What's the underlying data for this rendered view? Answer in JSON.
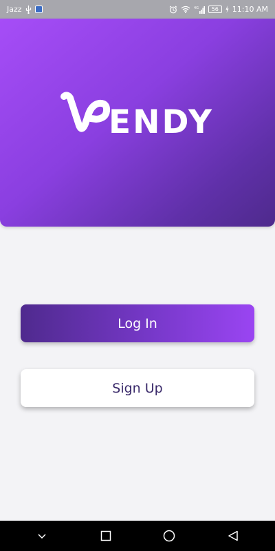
{
  "status_bar": {
    "carrier": "Jazz",
    "signal_type": "4G",
    "battery_level": "56",
    "time": "11:10 AM"
  },
  "brand": {
    "logo_text": "ENDY",
    "logo_full": "VENDY"
  },
  "actions": {
    "login_label": "Log In",
    "signup_label": "Sign Up"
  },
  "colors": {
    "header_gradient_start": "#a64df7",
    "header_gradient_end": "#4e2a8c",
    "login_gradient_start": "#4f2a8e",
    "login_gradient_end": "#9a45f2",
    "signup_text": "#3a2a6a",
    "background": "#f3f3f6"
  },
  "nav": {
    "icons": [
      "chevron-down-icon",
      "recents-square-icon",
      "home-circle-icon",
      "back-triangle-icon"
    ]
  }
}
